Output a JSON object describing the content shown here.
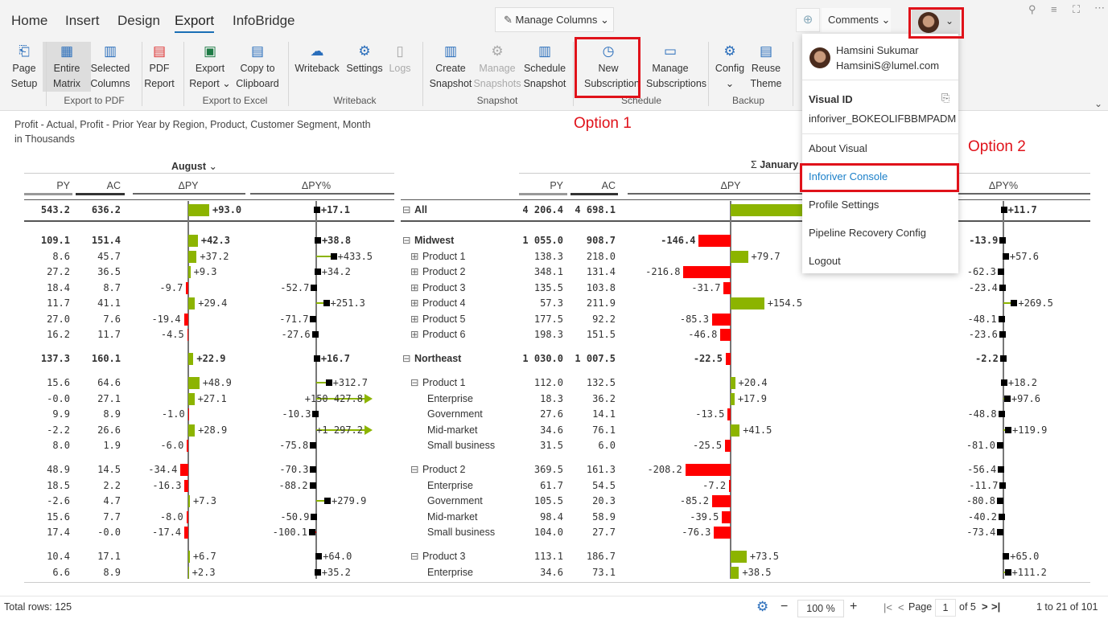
{
  "tabs": [
    "Home",
    "Insert",
    "Design",
    "Export",
    "InfoBridge"
  ],
  "active_tab": "Export",
  "manage_columns": "Manage Columns",
  "comments": "Comments",
  "ribbon": {
    "buttons": [
      {
        "l1": "Page",
        "l2": "Setup",
        "icon": "page-setup-icon",
        "state": "normal"
      },
      {
        "l1": "Entire",
        "l2": "Matrix",
        "icon": "table-icon",
        "state": "selected"
      },
      {
        "l1": "Selected",
        "l2": "Columns",
        "icon": "columns-icon",
        "state": "normal"
      },
      {
        "l1": "PDF",
        "l2": "Report",
        "icon": "pdf-icon",
        "state": "normal"
      },
      {
        "l1": "Export",
        "l2": "Report ⌄",
        "icon": "excel-icon",
        "state": "normal"
      },
      {
        "l1": "Copy to",
        "l2": "Clipboard",
        "icon": "clipboard-icon",
        "state": "normal"
      },
      {
        "l1": "Writeback",
        "l2": "",
        "icon": "cloud-upload-icon",
        "state": "normal"
      },
      {
        "l1": "Settings",
        "l2": "",
        "icon": "gear-icon",
        "state": "normal"
      },
      {
        "l1": "Logs",
        "l2": "",
        "icon": "book-icon",
        "state": "disabled"
      },
      {
        "l1": "Create",
        "l2": "Snapshot",
        "icon": "snapshot-icon",
        "state": "normal"
      },
      {
        "l1": "Manage",
        "l2": "Snapshots",
        "icon": "gear-icon",
        "state": "disabled"
      },
      {
        "l1": "Schedule",
        "l2": "Snapshot",
        "icon": "schedule-snapshot-icon",
        "state": "normal"
      },
      {
        "l1": "New",
        "l2": "Subscription",
        "icon": "clock-icon",
        "state": "normal"
      },
      {
        "l1": "Manage",
        "l2": "Subscriptions",
        "icon": "calendar-icon",
        "state": "normal"
      },
      {
        "l1": "Config",
        "l2": "⌄",
        "icon": "config-icon",
        "state": "normal"
      },
      {
        "l1": "Reuse",
        "l2": "Theme",
        "icon": "json-icon",
        "state": "normal"
      }
    ],
    "groups": [
      "Export to PDF",
      "Export to Excel",
      "Writeback",
      "Snapshot",
      "Schedule",
      "Backup"
    ]
  },
  "annotations": {
    "option1": "Option 1",
    "option2": "Option 2"
  },
  "user_menu": {
    "name": "Hamsini Sukumar",
    "email": "HamsiniS@lumel.com",
    "visual_id_label": "Visual ID",
    "visual_id": "inforiver_BOKEOLIFBBMPADM",
    "items": [
      "About Visual",
      "Inforiver Console",
      "Profile Settings",
      "Pipeline Recovery Config",
      "Logout"
    ],
    "highlighted": "Inforiver Console"
  },
  "report": {
    "title": "Profit - Actual, Profit - Prior Year by Region, Product, Customer Segment, Month",
    "subtitle": "in Thousands"
  },
  "columns": {
    "left_month": "August",
    "right_month": "January",
    "sigma": "Σ",
    "headers": [
      "PY",
      "AC",
      "ΔPY",
      "ΔPY%"
    ]
  },
  "colors": {
    "positive": "#8cb400",
    "negative": "#ff0000",
    "marker": "#000000",
    "highlight": "#e0121a",
    "accent": "#1a6fb5"
  },
  "rows": [
    {
      "label": "All",
      "level": 0,
      "exp": "⊟",
      "bold": true,
      "gap": false,
      "l": [
        "543.2",
        "636.2",
        "+93.0",
        "+17.1"
      ],
      "r": [
        "4 206.4",
        "4 698.1",
        "+491.7",
        "+11.7"
      ]
    },
    {
      "label": "Midwest",
      "level": 0,
      "exp": "⊟",
      "bold": true,
      "gap": true,
      "l": [
        "109.1",
        "151.4",
        "+42.3",
        "+38.8"
      ],
      "r": [
        "1 055.0",
        "908.7",
        "-146.4",
        "-13.9"
      ]
    },
    {
      "label": "Product 1",
      "level": 1,
      "exp": "⊞",
      "bold": false,
      "gap": false,
      "l": [
        "8.6",
        "45.7",
        "+37.2",
        "+433.5"
      ],
      "r": [
        "138.3",
        "218.0",
        "+79.7",
        "+57.6"
      ]
    },
    {
      "label": "Product 2",
      "level": 1,
      "exp": "⊞",
      "bold": false,
      "gap": false,
      "l": [
        "27.2",
        "36.5",
        "+9.3",
        "+34.2"
      ],
      "r": [
        "348.1",
        "131.4",
        "-216.8",
        "-62.3"
      ]
    },
    {
      "label": "Product 3",
      "level": 1,
      "exp": "⊞",
      "bold": false,
      "gap": false,
      "l": [
        "18.4",
        "8.7",
        "-9.7",
        "-52.7"
      ],
      "r": [
        "135.5",
        "103.8",
        "-31.7",
        "-23.4"
      ]
    },
    {
      "label": "Product 4",
      "level": 1,
      "exp": "⊞",
      "bold": false,
      "gap": false,
      "l": [
        "11.7",
        "41.1",
        "+29.4",
        "+251.3"
      ],
      "r": [
        "57.3",
        "211.9",
        "+154.5",
        "+269.5"
      ]
    },
    {
      "label": "Product 5",
      "level": 1,
      "exp": "⊞",
      "bold": false,
      "gap": false,
      "l": [
        "27.0",
        "7.6",
        "-19.4",
        "-71.7"
      ],
      "r": [
        "177.5",
        "92.2",
        "-85.3",
        "-48.1"
      ]
    },
    {
      "label": "Product 6",
      "level": 1,
      "exp": "⊞",
      "bold": false,
      "gap": false,
      "l": [
        "16.2",
        "11.7",
        "-4.5",
        "-27.6"
      ],
      "r": [
        "198.3",
        "151.5",
        "-46.8",
        "-23.6"
      ]
    },
    {
      "label": "Northeast",
      "level": 0,
      "exp": "⊟",
      "bold": true,
      "gap": true,
      "l": [
        "137.3",
        "160.1",
        "+22.9",
        "+16.7"
      ],
      "r": [
        "1 030.0",
        "1 007.5",
        "-22.5",
        "-2.2"
      ]
    },
    {
      "label": "Product 1",
      "level": 1,
      "exp": "⊟",
      "bold": false,
      "gap": true,
      "l": [
        "15.6",
        "64.6",
        "+48.9",
        "+312.7"
      ],
      "r": [
        "112.0",
        "132.5",
        "+20.4",
        "+18.2"
      ]
    },
    {
      "label": "Enterprise",
      "level": 2,
      "exp": "",
      "bold": false,
      "gap": false,
      "l": [
        "-0.0",
        "27.1",
        "+27.1",
        "+150 427.8"
      ],
      "r": [
        "18.3",
        "36.2",
        "+17.9",
        "+97.6"
      ]
    },
    {
      "label": "Government",
      "level": 2,
      "exp": "",
      "bold": false,
      "gap": false,
      "l": [
        "9.9",
        "8.9",
        "-1.0",
        "-10.3"
      ],
      "r": [
        "27.6",
        "14.1",
        "-13.5",
        "-48.8"
      ]
    },
    {
      "label": "Mid-market",
      "level": 2,
      "exp": "",
      "bold": false,
      "gap": false,
      "l": [
        "-2.2",
        "26.6",
        "+28.9",
        "+1 297.2"
      ],
      "r": [
        "34.6",
        "76.1",
        "+41.5",
        "+119.9"
      ]
    },
    {
      "label": "Small business",
      "level": 2,
      "exp": "",
      "bold": false,
      "gap": false,
      "l": [
        "8.0",
        "1.9",
        "-6.0",
        "-75.8"
      ],
      "r": [
        "31.5",
        "6.0",
        "-25.5",
        "-81.0"
      ]
    },
    {
      "label": "Product 2",
      "level": 1,
      "exp": "⊟",
      "bold": false,
      "gap": true,
      "l": [
        "48.9",
        "14.5",
        "-34.4",
        "-70.3"
      ],
      "r": [
        "369.5",
        "161.3",
        "-208.2",
        "-56.4"
      ]
    },
    {
      "label": "Enterprise",
      "level": 2,
      "exp": "",
      "bold": false,
      "gap": false,
      "l": [
        "18.5",
        "2.2",
        "-16.3",
        "-88.2"
      ],
      "r": [
        "61.7",
        "54.5",
        "-7.2",
        "-11.7"
      ]
    },
    {
      "label": "Government",
      "level": 2,
      "exp": "",
      "bold": false,
      "gap": false,
      "l": [
        "-2.6",
        "4.7",
        "+7.3",
        "+279.9"
      ],
      "r": [
        "105.5",
        "20.3",
        "-85.2",
        "-80.8"
      ]
    },
    {
      "label": "Mid-market",
      "level": 2,
      "exp": "",
      "bold": false,
      "gap": false,
      "l": [
        "15.6",
        "7.7",
        "-8.0",
        "-50.9"
      ],
      "r": [
        "98.4",
        "58.9",
        "-39.5",
        "-40.2"
      ]
    },
    {
      "label": "Small business",
      "level": 2,
      "exp": "",
      "bold": false,
      "gap": false,
      "l": [
        "17.4",
        "-0.0",
        "-17.4",
        "-100.1"
      ],
      "r": [
        "104.0",
        "27.7",
        "-76.3",
        "-73.4"
      ]
    },
    {
      "label": "Product 3",
      "level": 1,
      "exp": "⊟",
      "bold": false,
      "gap": true,
      "l": [
        "10.4",
        "17.1",
        "+6.7",
        "+64.0"
      ],
      "r": [
        "113.1",
        "186.7",
        "+73.5",
        "+65.0"
      ]
    },
    {
      "label": "Enterprise",
      "level": 2,
      "exp": "",
      "bold": false,
      "gap": false,
      "l": [
        "6.6",
        "8.9",
        "+2.3",
        "+35.2"
      ],
      "r": [
        "34.6",
        "73.1",
        "+38.5",
        "+111.2"
      ]
    }
  ],
  "footer": {
    "total_rows": "Total rows: 125",
    "zoom": "100 %",
    "page_label": "Page",
    "page": "1",
    "of_pages": "of 5",
    "range": "1 to 21 of 101"
  }
}
